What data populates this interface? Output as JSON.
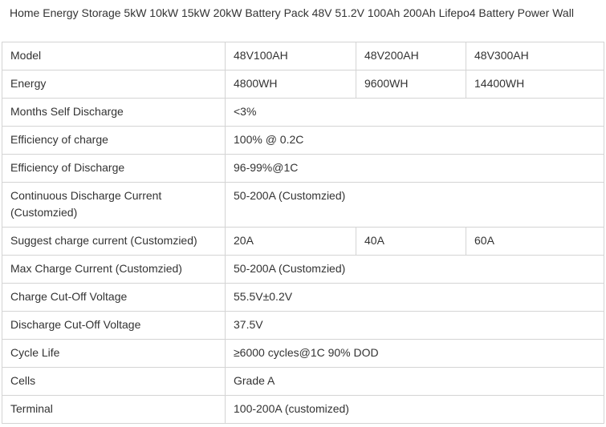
{
  "title": "Home Energy Storage 5kW 10kW 15kW 20kW Battery Pack 48V 51.2V 100Ah 200Ah Lifepo4 Battery Power Wall",
  "rows": [
    {
      "label": "Model",
      "cells": [
        "48V100AH",
        "48V200AH",
        "48V300AH"
      ]
    },
    {
      "label": "Energy",
      "cells": [
        "4800WH",
        "9600WH",
        "14400WH"
      ]
    },
    {
      "label": "Months Self Discharge",
      "value": "<3%"
    },
    {
      "label": "Efficiency of charge",
      "value": "100% @ 0.2C"
    },
    {
      "label": "Efficiency of Discharge",
      "value": "96-99%@1C"
    },
    {
      "label": "Continuous Discharge Current (Customzied)",
      "value": "50-200A (Customzied)"
    },
    {
      "label": "Suggest charge current (Customzied)",
      "cells": [
        "20A",
        "40A",
        "60A"
      ]
    },
    {
      "label": "Max Charge Current (Customzied)",
      "value": "50-200A (Customzied)"
    },
    {
      "label": "Charge Cut-Off Voltage",
      "value": "55.5V±0.2V"
    },
    {
      "label": "Discharge Cut-Off Voltage",
      "value": "37.5V"
    },
    {
      "label": "Cycle Life",
      "value": "≥6000 cycles@1C 90% DOD"
    },
    {
      "label": "Cells",
      "value": "Grade A"
    },
    {
      "label": "Terminal",
      "value": "100-200A (customized)"
    }
  ]
}
